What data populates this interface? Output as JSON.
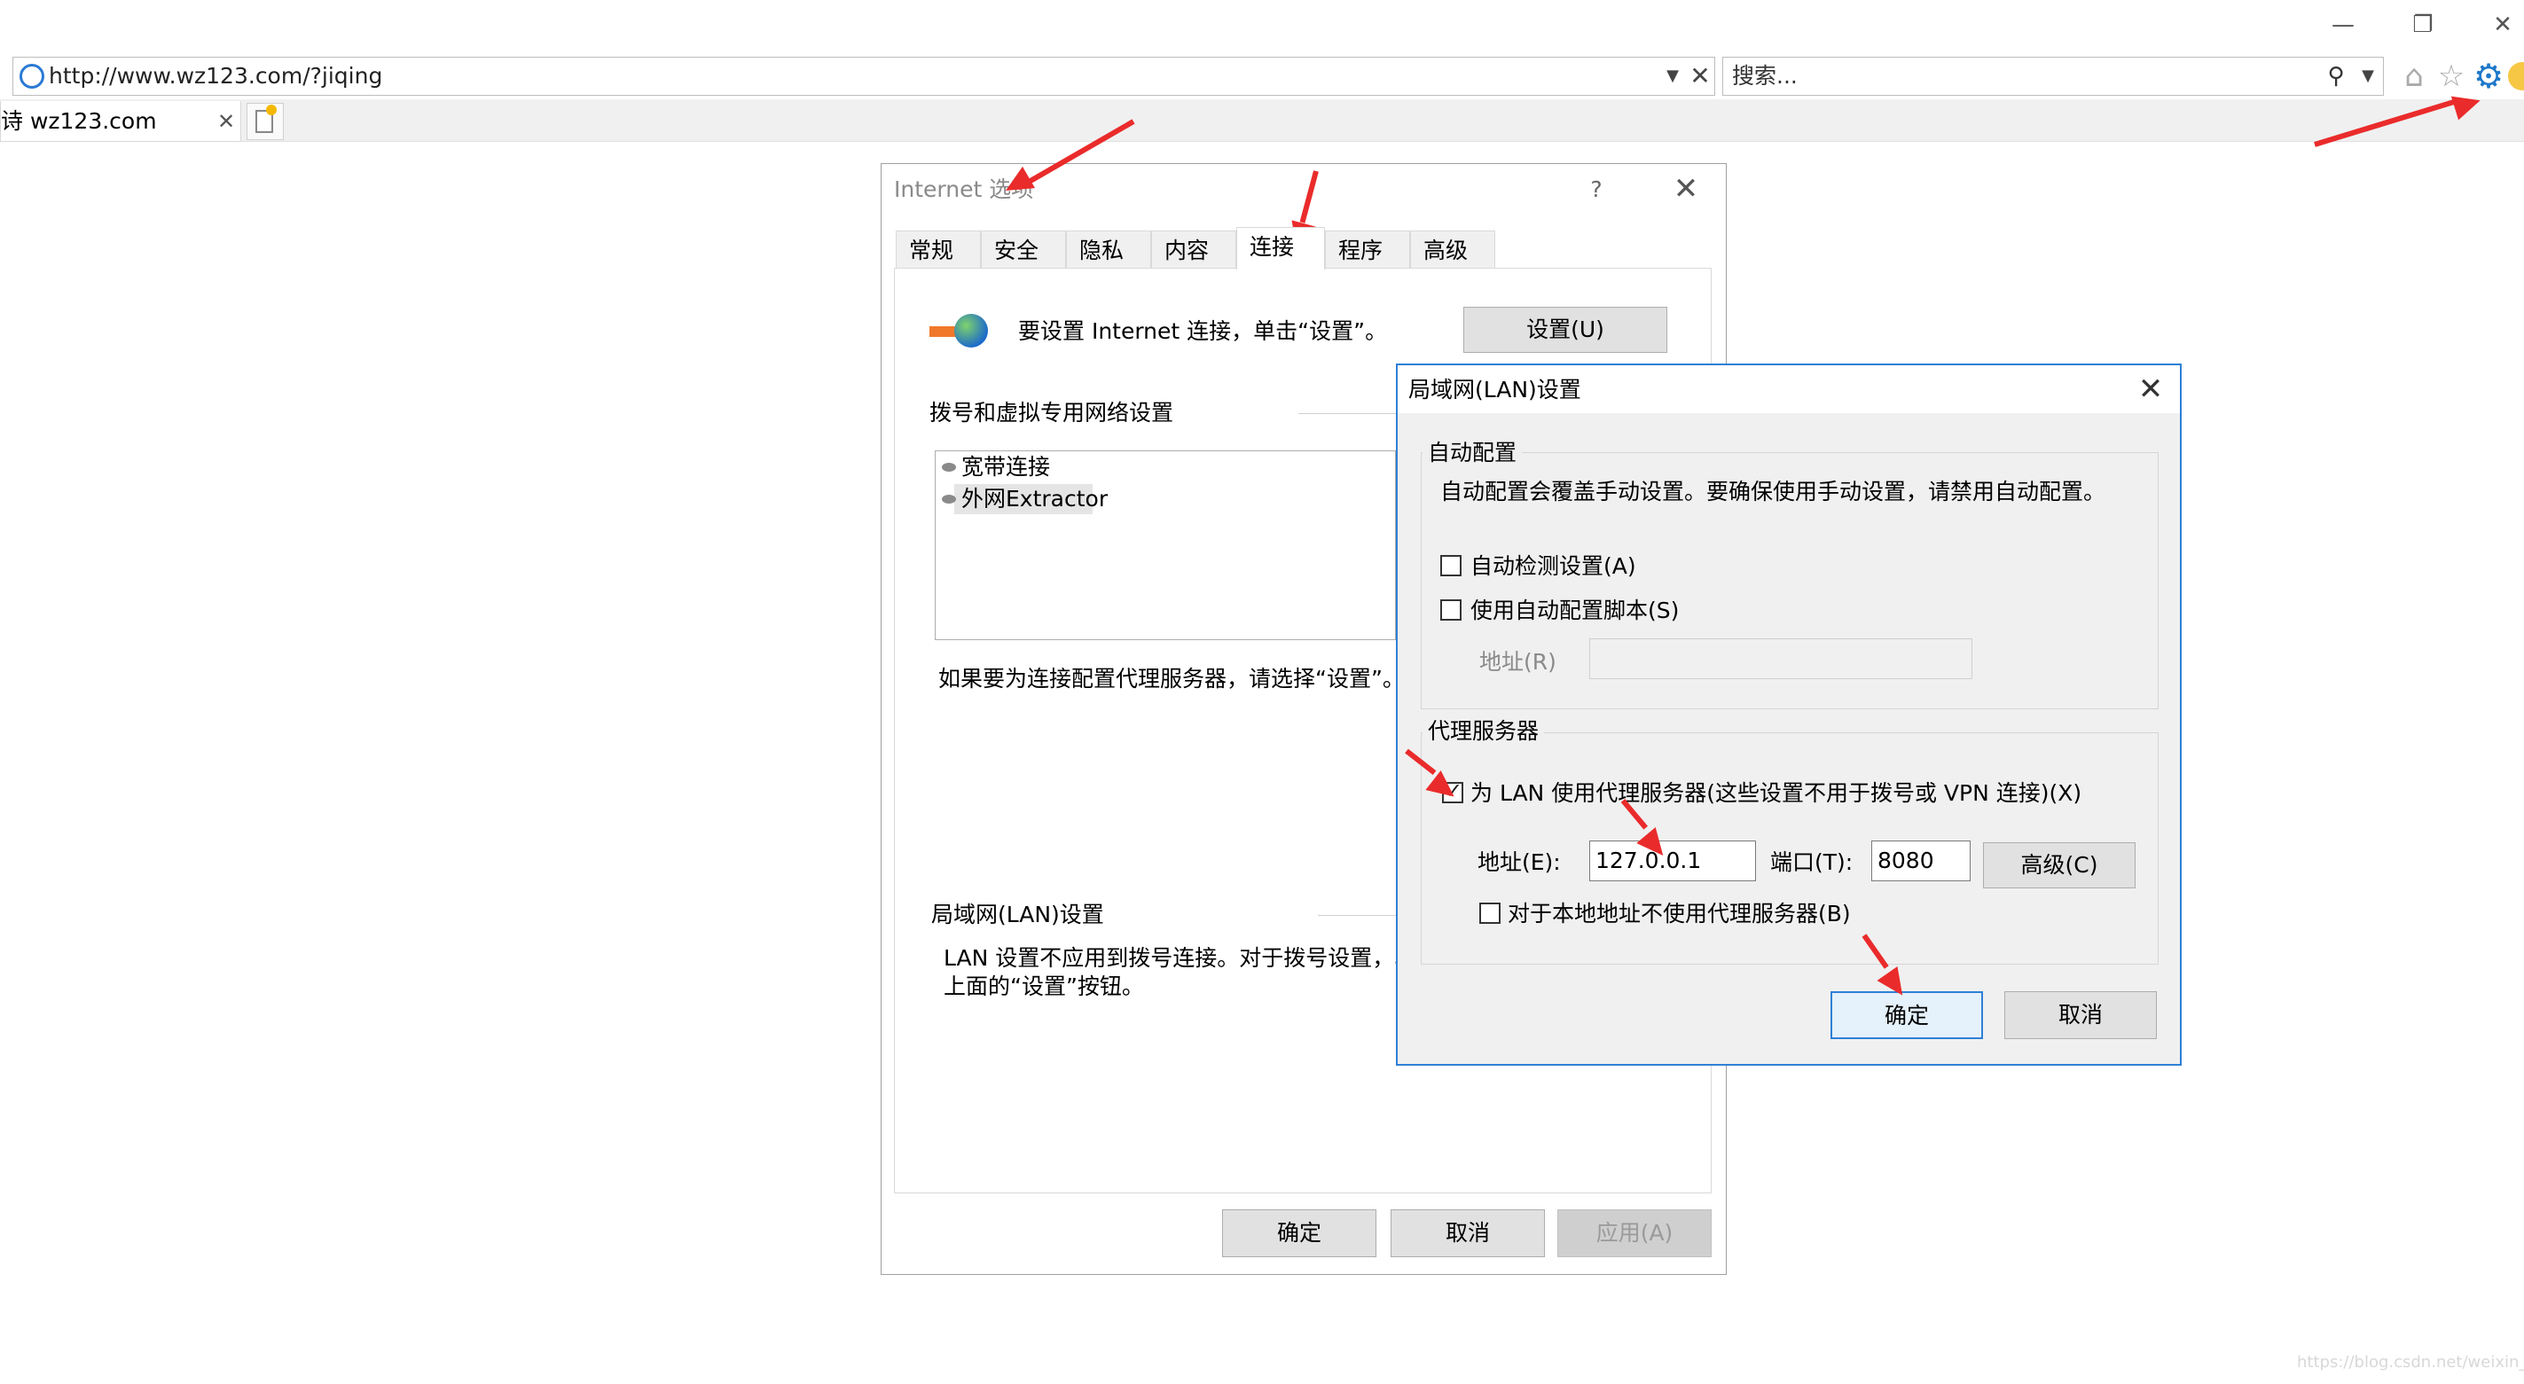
{
  "browser": {
    "address": "http://www.wz123.com/?jiqing",
    "search_placeholder": "搜索...",
    "tab_title": "诗 wz123.com",
    "window_controls": {
      "minimize": "—",
      "restore": "❐",
      "close": "✕"
    },
    "icons": [
      "ie-icon",
      "dropdown-icon",
      "close-icon",
      "search-icon",
      "home-icon",
      "favorites-star-icon",
      "gear-icon",
      "smiley-icon",
      "new-tab-icon"
    ]
  },
  "internet_options": {
    "title": "Internet 选项",
    "help": "?",
    "close": "✕",
    "tabs": [
      "常规",
      "安全",
      "隐私",
      "内容",
      "连接",
      "程序",
      "高级"
    ],
    "active_tab": "连接",
    "setup_text": "要设置 Internet 连接，单击“设置”。",
    "setup_button": "设置(U)",
    "dialup_label": "拨号和虚拟专用网络设置",
    "dialup_items": [
      "宽带连接",
      "外网Extractor"
    ],
    "proxy_hint": "如果要为连接配置代理服务器，请选择“设置”。",
    "lan_label": "局域网(LAN)设置",
    "lan_desc_line1": "LAN 设置不应用到拨号连接。对于拨号设置，单",
    "lan_desc_line2": "上面的“设置”按钮。",
    "buttons": {
      "ok": "确定",
      "cancel": "取消",
      "apply": "应用(A)"
    }
  },
  "lan_settings": {
    "title": "局域网(LAN)设置",
    "close": "✕",
    "auto_config": {
      "label": "自动配置",
      "note": "自动配置会覆盖手动设置。要确保使用手动设置，请禁用自动配置。",
      "auto_detect": {
        "label": "自动检测设置(A)",
        "checked": false
      },
      "use_script": {
        "label": "使用自动配置脚本(S)",
        "checked": false
      },
      "address_label": "地址(R)",
      "address_value": ""
    },
    "proxy": {
      "label": "代理服务器",
      "use_proxy": {
        "label": "为 LAN 使用代理服务器(这些设置不用于拨号或 VPN 连接)(X)",
        "checked": true
      },
      "address_label": "地址(E):",
      "address_value": "127.0.0.1",
      "port_label": "端口(T):",
      "port_value": "8080",
      "advanced_button": "高级(C)",
      "bypass_local": {
        "label": "对于本地地址不使用代理服务器(B)",
        "checked": false
      }
    },
    "buttons": {
      "ok": "确定",
      "cancel": "取消"
    }
  },
  "colors": {
    "accent": "#2f7fd6",
    "annotation_arrow": "#ea2b2b",
    "dialog_bg": "#f0f0f0"
  },
  "watermark": "https://blog.csdn.net/weixin_..."
}
